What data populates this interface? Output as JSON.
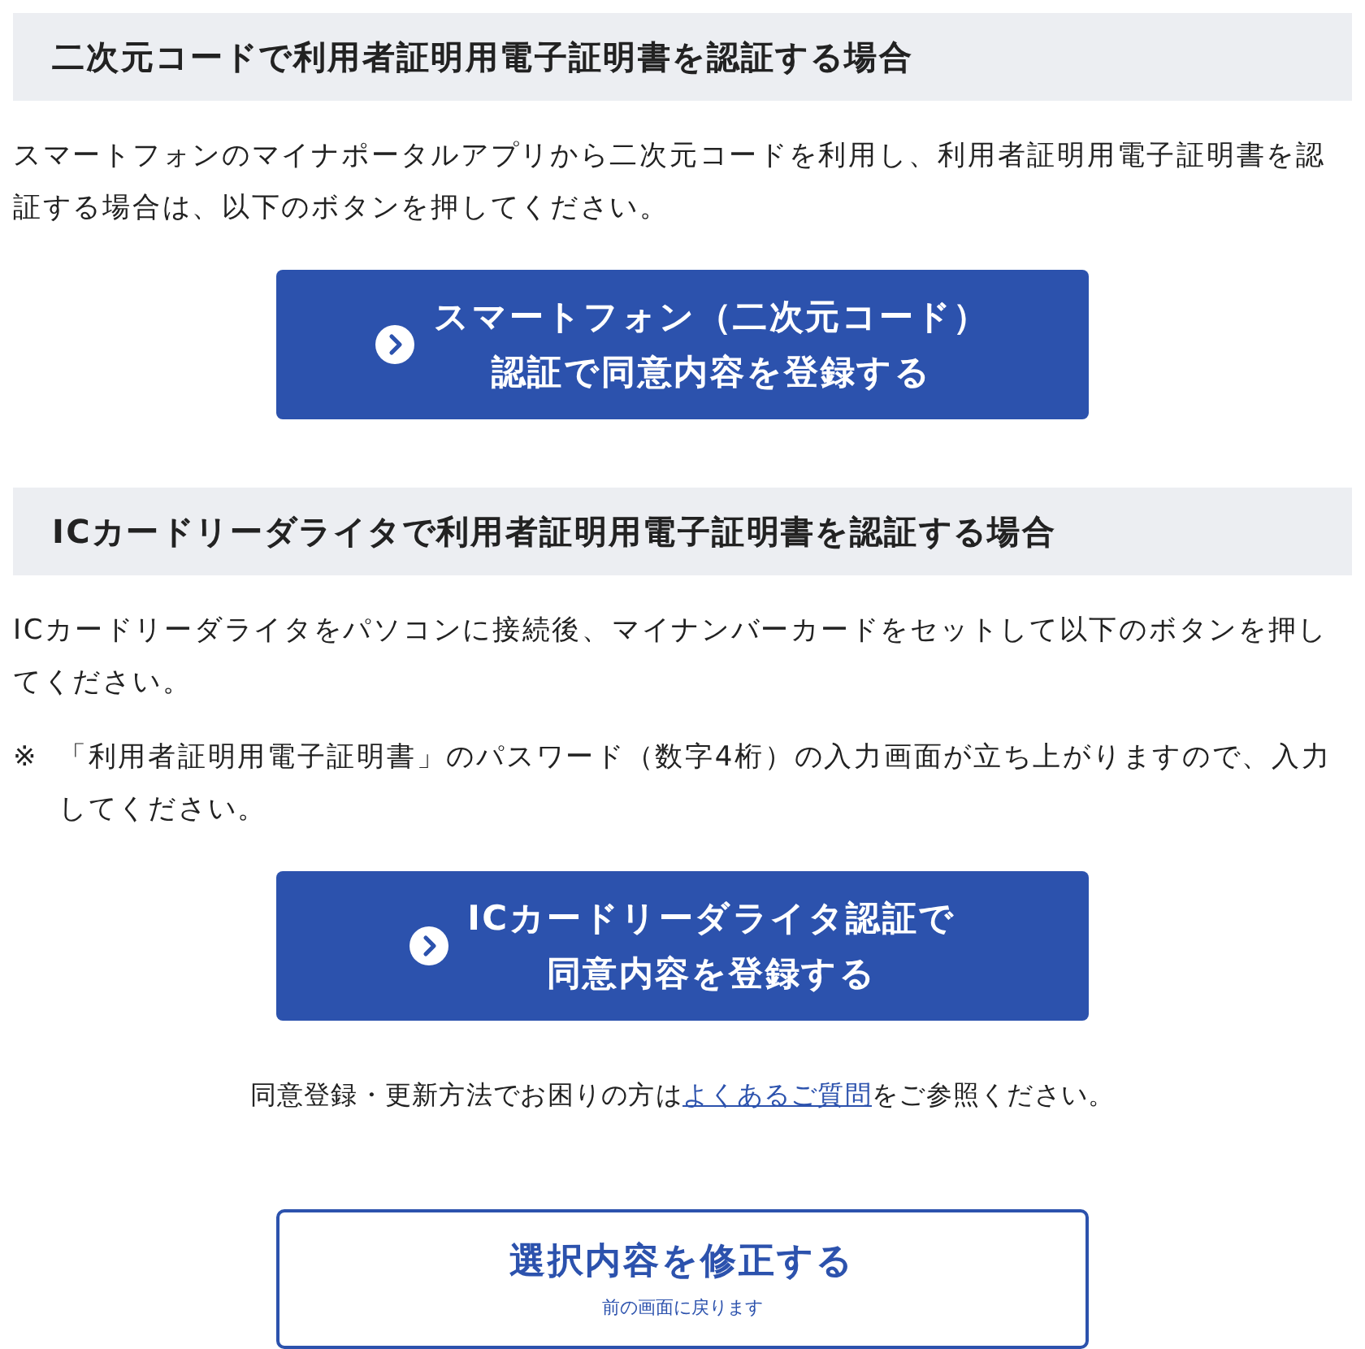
{
  "sections": [
    {
      "heading": "二次元コードで利用者証明用電子証明書を認証する場合",
      "paragraph": "スマートフォンのマイナポータルアプリから二次元コードを利用し、利用者証明用電子証明書を認証する場合は、以下のボタンを押してください。",
      "button": {
        "lines": [
          "スマートフォン（二次元コード）",
          "認証で同意内容を登録する"
        ]
      }
    },
    {
      "heading": "ICカードリーダライタで利用者証明用電子証明書を認証する場合",
      "paragraph": "ICカードリーダライタをパソコンに接続後、マイナンバーカードをセットして以下のボタンを押してください。",
      "note": {
        "mark": "※",
        "text": "「利用者証明用電子証明書」のパスワード（数字4桁）の入力画面が立ち上がりますので、入力してください。"
      },
      "button": {
        "lines": [
          "ICカードリーダライタ認証で",
          "同意内容を登録する"
        ]
      }
    }
  ],
  "help": {
    "before": "同意登録・更新方法でお困りの方は",
    "link": "よくあるご質問",
    "after": "をご参照ください。"
  },
  "back_button": {
    "title": "選択内容を修正する",
    "subtitle": "前の画面に戻ります"
  }
}
